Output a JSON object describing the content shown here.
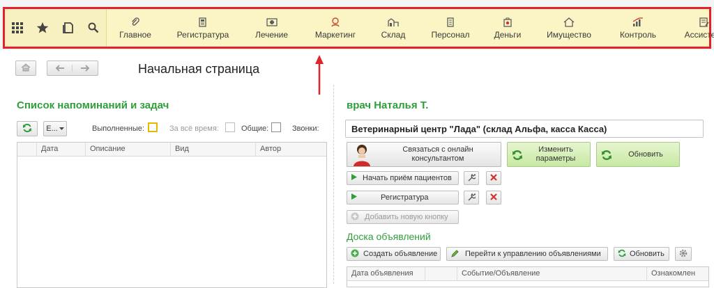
{
  "toolbar": {
    "sections": [
      {
        "label": "Главное",
        "icon": "paperclip-icon"
      },
      {
        "label": "Регистратура",
        "icon": "registry-icon"
      },
      {
        "label": "Лечение",
        "icon": "treatment-icon"
      },
      {
        "label": "Маркетинг",
        "icon": "marketing-icon"
      },
      {
        "label": "Склад",
        "icon": "warehouse-icon"
      },
      {
        "label": "Персонал",
        "icon": "staff-icon"
      },
      {
        "label": "Деньги",
        "icon": "money-icon"
      },
      {
        "label": "Имущество",
        "icon": "property-icon"
      },
      {
        "label": "Контроль",
        "icon": "control-icon"
      },
      {
        "label": "Ассистент",
        "icon": "assistant-icon"
      }
    ]
  },
  "page": {
    "title": "Начальная страница"
  },
  "tasks": {
    "title": "Список напоминаний и задач",
    "dropdown_label": "Е...",
    "filters": {
      "done_label": "Выполненные:",
      "all_time_label": "За всё время:",
      "common_label": "Общие:",
      "calls_label": "Звонки:"
    },
    "columns": [
      "Дата",
      "Описание",
      "Вид",
      "Автор"
    ]
  },
  "doctor": {
    "title": "врач Наталья Т.",
    "organization": "Ветеринарный центр \"Лада\" (склад Альфа, касса Касса)",
    "contact_button": "Связаться с онлайн консультантом",
    "change_params_button": "Изменить параметры",
    "refresh_button": "Обновить",
    "start_reception_button": "Начать приём пациентов",
    "registry_button": "Регистратура",
    "add_button": "Добавить новую кнопку"
  },
  "board": {
    "title": "Доска объявлений",
    "create_button": "Создать объявление",
    "manage_button": "Перейти к управлению объявлениями",
    "refresh_button": "Обновить",
    "columns": [
      "Дата объявления",
      "",
      "Событие/Объявление",
      "Ознакомлен"
    ]
  },
  "colors": {
    "highlight_border": "#e0222a",
    "section_bg": "#fbf4c4",
    "title_green": "#2f9e3a",
    "green_button": "#c7e8a4"
  }
}
